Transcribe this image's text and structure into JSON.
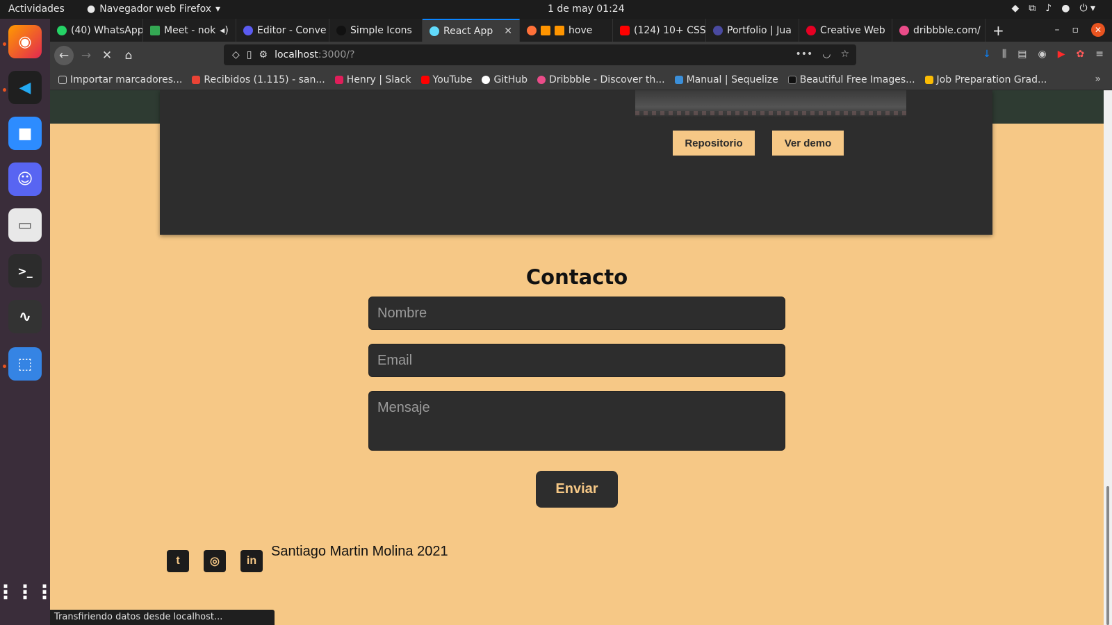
{
  "system": {
    "activities": "Actividades",
    "app_name": "Navegador web Firefox",
    "clock": "1 de may  01:24"
  },
  "tabs": [
    {
      "label": "(40) WhatsApp",
      "color": "#25d366"
    },
    {
      "label": "Meet - nok",
      "color": "#34a853"
    },
    {
      "label": "Editor - Conve",
      "color": "#5b5bf0"
    },
    {
      "label": "Simple Icons",
      "color": "#111111"
    },
    {
      "label": "React App",
      "color": "#61dafb"
    },
    {
      "label": "hove",
      "color": "#ff7139"
    },
    {
      "label": "(124) 10+ CSS",
      "color": "#ff0000"
    },
    {
      "label": "Portfolio | Jua",
      "color": "#4a4aa0"
    },
    {
      "label": "Creative Web",
      "color": "#e60023"
    },
    {
      "label": "dribbble.com/",
      "color": "#ea4c89"
    }
  ],
  "urlbar": {
    "host": "localhost",
    "rest": ":3000/?"
  },
  "bookmarks": [
    {
      "label": "Importar marcadores...",
      "color": "#cccccc"
    },
    {
      "label": "Recibidos (1.115) - san...",
      "color": "#ea4335"
    },
    {
      "label": "Henry | Slack",
      "color": "#e01e5a"
    },
    {
      "label": "YouTube",
      "color": "#ff0000"
    },
    {
      "label": "GitHub",
      "color": "#ffffff"
    },
    {
      "label": "Dribbble - Discover th...",
      "color": "#ea4c89"
    },
    {
      "label": "Manual | Sequelize",
      "color": "#3b8fd9"
    },
    {
      "label": "Beautiful Free Images...",
      "color": "#111111"
    },
    {
      "label": "Job Preparation Grad...",
      "color": "#fbbc04"
    }
  ],
  "project_card": {
    "repo_button": "Repositorio",
    "demo_button": "Ver demo"
  },
  "contact": {
    "title": "Contacto",
    "name_placeholder": "Nombre",
    "email_placeholder": "Email",
    "message_placeholder": "Mensaje",
    "send_button": "Enviar"
  },
  "footer": {
    "name": "Santiago Martin Molina 2021",
    "social_icons": [
      "twitter-icon",
      "github-icon",
      "linkedin-icon"
    ]
  },
  "status_text": "Transfiriendo datos desde localhost...",
  "colors": {
    "page_background": "#f6c886",
    "card_background": "#2d2d2d",
    "header_band": "#2e3b32",
    "accent": "#f6c886"
  }
}
